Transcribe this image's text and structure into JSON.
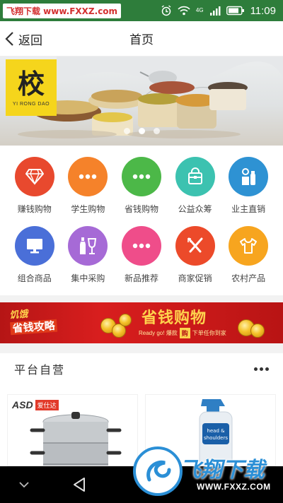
{
  "status_bar": {
    "watermark": "飞翔下载 www.FXXZ.com",
    "network": "4G",
    "time": "11:09"
  },
  "nav": {
    "back_label": "返回",
    "title": "首页"
  },
  "banner": {
    "logo_char": "校",
    "logo_sub": "YI RONG DAO",
    "slide_count": 3,
    "active_slide": 2
  },
  "categories": [
    {
      "label": "赚钱购物",
      "color": "#e8492e",
      "icon": "diamond-icon"
    },
    {
      "label": "学生购物",
      "color": "#f5822a",
      "icon": "dots-icon"
    },
    {
      "label": "省钱购物",
      "color": "#4cb848",
      "icon": "dots-icon"
    },
    {
      "label": "公益众筹",
      "color": "#3cc2b0",
      "icon": "bag-icon"
    },
    {
      "label": "业主直销",
      "color": "#2e92d3",
      "icon": "bottle-icon"
    },
    {
      "label": "组合商品",
      "color": "#4a6fd8",
      "icon": "monitor-icon"
    },
    {
      "label": "集中采购",
      "color": "#a66ad6",
      "icon": "wine-icon"
    },
    {
      "label": "新品推荐",
      "color": "#ef4d8a",
      "icon": "dots-icon"
    },
    {
      "label": "商家促销",
      "color": "#ec4a2a",
      "icon": "cutlery-icon"
    },
    {
      "label": "农村产品",
      "color": "#f7a51f",
      "icon": "shirt-icon"
    }
  ],
  "promo": {
    "left_line1": "饥饿",
    "left_line2": "省钱攻略",
    "title": "省钱购物",
    "sub_left": "Ready go! 爆款",
    "sub_highlight": "购",
    "sub_right": "下单任你到家"
  },
  "section": {
    "title": "平台自营"
  },
  "products": [
    {
      "brand": "ASD",
      "badge": "爱仕达"
    },
    {
      "brand": "head & shoulders"
    }
  ],
  "watermark_bottom": {
    "text": "飞翔下载",
    "url": "WWW.FXXZ.COM"
  },
  "colors": {
    "status_bg": "#2e7d3b",
    "promo_red": "#c91919",
    "accent_gold": "#ffd34d"
  }
}
